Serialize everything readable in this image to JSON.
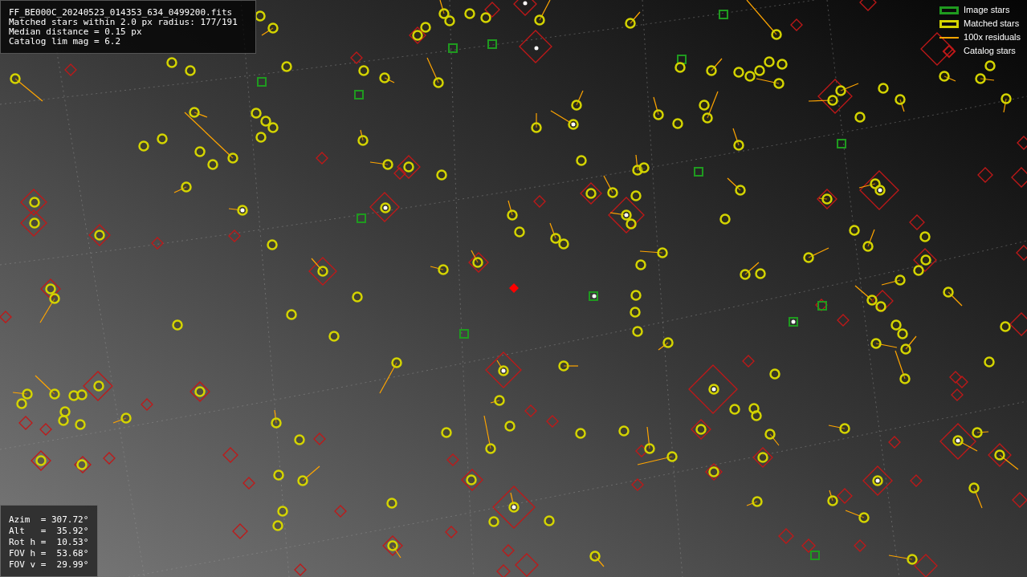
{
  "info": {
    "lines": [
      "FF_BE000C_20240523_014353_634_0499200.fits",
      "Matched stars within 2.0 px radius: 177/191",
      "Median distance = 0.15 px",
      "Catalog lim mag = 6.2"
    ]
  },
  "legend": [
    {
      "kind": "image",
      "label": "Image stars",
      "color": "#1f9a1f"
    },
    {
      "kind": "matched",
      "label": "Matched stars",
      "color": "#d4d400"
    },
    {
      "kind": "residual",
      "label": "100x residuals",
      "color": "#ffa500"
    },
    {
      "kind": "catalog",
      "label": "Catalog stars",
      "color": "#c01818"
    }
  ],
  "pointing": {
    "lines": [
      "Azim  = 307.72°",
      "Alt   =  35.92°",
      "Rot h =  10.53°",
      "FOV h =  53.68°",
      "FOV v =  29.99°"
    ]
  }
}
